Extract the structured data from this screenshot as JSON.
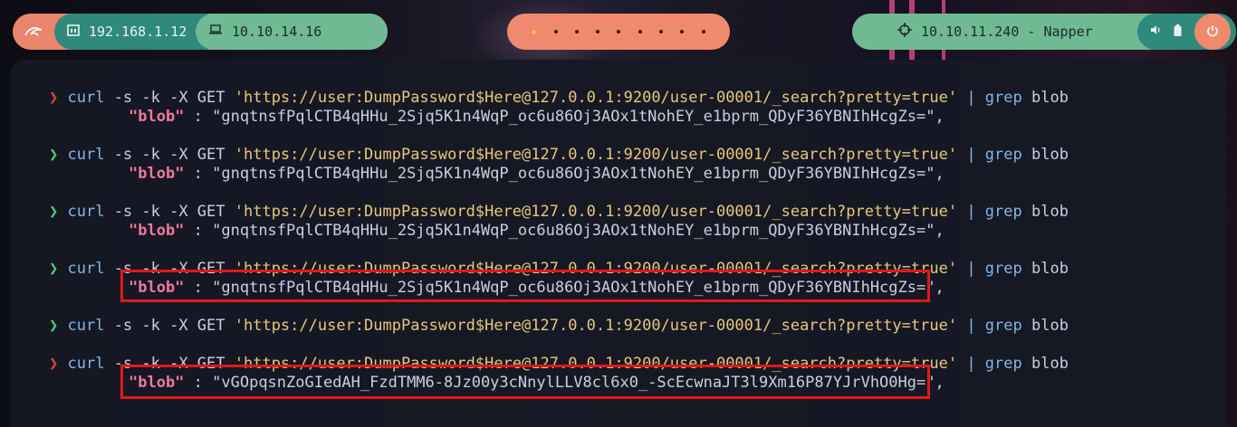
{
  "topbar": {
    "kali_icon": "kali-dragon-icon",
    "lan_ip": "192.168.1.12",
    "vpn_ip": "10.10.14.16",
    "workspaces": 9,
    "active_workspace": 1,
    "target": "10.10.11.240 - Napper"
  },
  "terminal": {
    "entries": [
      {
        "status": "error",
        "prompt": "❯",
        "cmd": "curl",
        "args": " -s -k -X GET ",
        "url": "'https://user:DumpPassword$Here@127.0.0.1:9200/user-00001/_search?pretty=true'",
        "pipe": " | ",
        "grep": "grep",
        "grep_arg": " blob",
        "out_key": "\"blob\"",
        "out_sep": " : ",
        "out_val": "\"gnqtnsfPqlCTB4qHHu_2Sjq5K1n4WqP_oc6u86Oj3AOx1tNohEY_e1bprm_QDyF36YBNIhHcgZs=\","
      },
      {
        "status": "ok",
        "prompt": "❯",
        "cmd": "curl",
        "args": " -s -k -X GET ",
        "url": "'https://user:DumpPassword$Here@127.0.0.1:9200/user-00001/_search?pretty=true'",
        "pipe": " | ",
        "grep": "grep",
        "grep_arg": " blob",
        "out_key": "\"blob\"",
        "out_sep": " : ",
        "out_val": "\"gnqtnsfPqlCTB4qHHu_2Sjq5K1n4WqP_oc6u86Oj3AOx1tNohEY_e1bprm_QDyF36YBNIhHcgZs=\","
      },
      {
        "status": "ok",
        "prompt": "❯",
        "cmd": "curl",
        "args": " -s -k -X GET ",
        "url": "'https://user:DumpPassword$Here@127.0.0.1:9200/user-00001/_search?pretty=true'",
        "pipe": " | ",
        "grep": "grep",
        "grep_arg": " blob",
        "out_key": "\"blob\"",
        "out_sep": " : ",
        "out_val": "\"gnqtnsfPqlCTB4qHHu_2Sjq5K1n4WqP_oc6u86Oj3AOx1tNohEY_e1bprm_QDyF36YBNIhHcgZs=\","
      },
      {
        "status": "ok",
        "prompt": "❯",
        "cmd": "curl",
        "args": " -s -k -X GET ",
        "url": "'https://user:DumpPassword$Here@127.0.0.1:9200/user-00001/_search?pretty=true'",
        "pipe": " | ",
        "grep": "grep",
        "grep_arg": " blob",
        "out_key": "\"blob\"",
        "out_sep": " : ",
        "out_val": "\"gnqtnsfPqlCTB4qHHu_2Sjq5K1n4WqP_oc6u86Oj3AOx1tNohEY_e1bprm_QDyF36YBNIhHcgZs=\","
      },
      {
        "status": "ok",
        "prompt": "❯",
        "cmd": "curl",
        "args": " -s -k -X GET ",
        "url": "'https://user:DumpPassword$Here@127.0.0.1:9200/user-00001/_search?pretty=true'",
        "pipe": " | ",
        "grep": "grep",
        "grep_arg": " blob"
      },
      {
        "status": "error",
        "prompt": "❯",
        "cmd": "curl",
        "args": " -s -k -X GET ",
        "url": "'https://user:DumpPassword$Here@127.0.0.1:9200/user-00001/_search?pretty=true'",
        "pipe": " | ",
        "grep": "grep",
        "grep_arg": " blob",
        "out_key": "\"blob\"",
        "out_sep": " : ",
        "out_val": "\"vGOpqsnZoGIedAH_FzdTMM6-8Jz00y3cNnylLLV8cl6x0_-ScEcwnaJT3l9Xm16P87YJrVhO0Hg=\","
      }
    ]
  },
  "colors": {
    "prompt_error": "#e34141",
    "prompt_ok": "#58c97a",
    "highlight_box": "#e21818"
  }
}
